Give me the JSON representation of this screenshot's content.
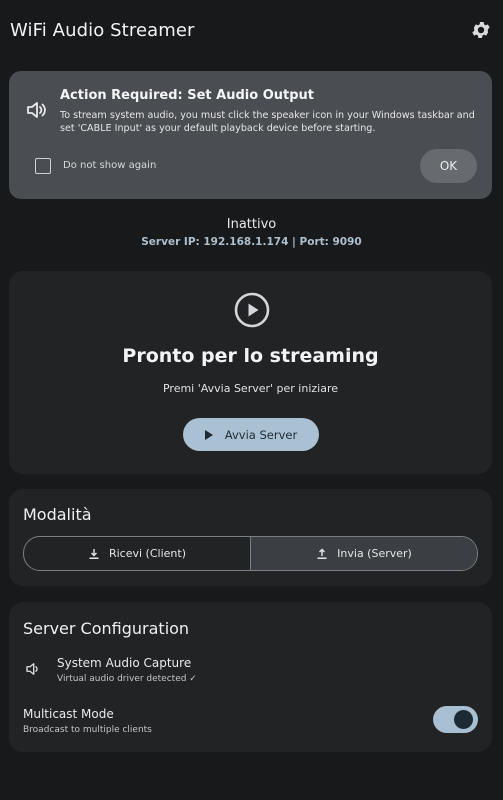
{
  "header": {
    "title": "WiFi Audio Streamer",
    "settings_icon": "gear-icon"
  },
  "alert": {
    "icon": "speaker-icon",
    "title": "Action Required: Set Audio Output",
    "body": "To stream system audio, you must click the speaker icon in your Windows taskbar and set 'CABLE Input' as your default playback device before starting.",
    "checkbox_label": "Do not show again",
    "checkbox_checked": false,
    "ok_label": "OK"
  },
  "status": {
    "text": "Inattivo",
    "server_ip": "Server IP: 192.168.1.174 | Port: 9090"
  },
  "hero": {
    "icon": "play-circle-icon",
    "title": "Pronto per lo streaming",
    "subtitle": "Premi 'Avvia Server' per iniziare",
    "start_label": "Avvia Server"
  },
  "mode": {
    "title": "Modalità",
    "options": [
      {
        "label": "Ricevi (Client)",
        "icon": "download-icon",
        "selected": false
      },
      {
        "label": "Invia (Server)",
        "icon": "upload-icon",
        "selected": true
      }
    ]
  },
  "config": {
    "title": "Server Configuration",
    "capture_label": "System Audio Capture",
    "capture_sub": "Virtual audio driver detected ✓",
    "multicast_label": "Multicast Mode",
    "multicast_sub": "Broadcast to multiple clients",
    "multicast_enabled": true
  },
  "colors": {
    "background": "#18191b",
    "card": "#222325",
    "alert": "#4a4d51",
    "accent": "#a9c1d3"
  }
}
